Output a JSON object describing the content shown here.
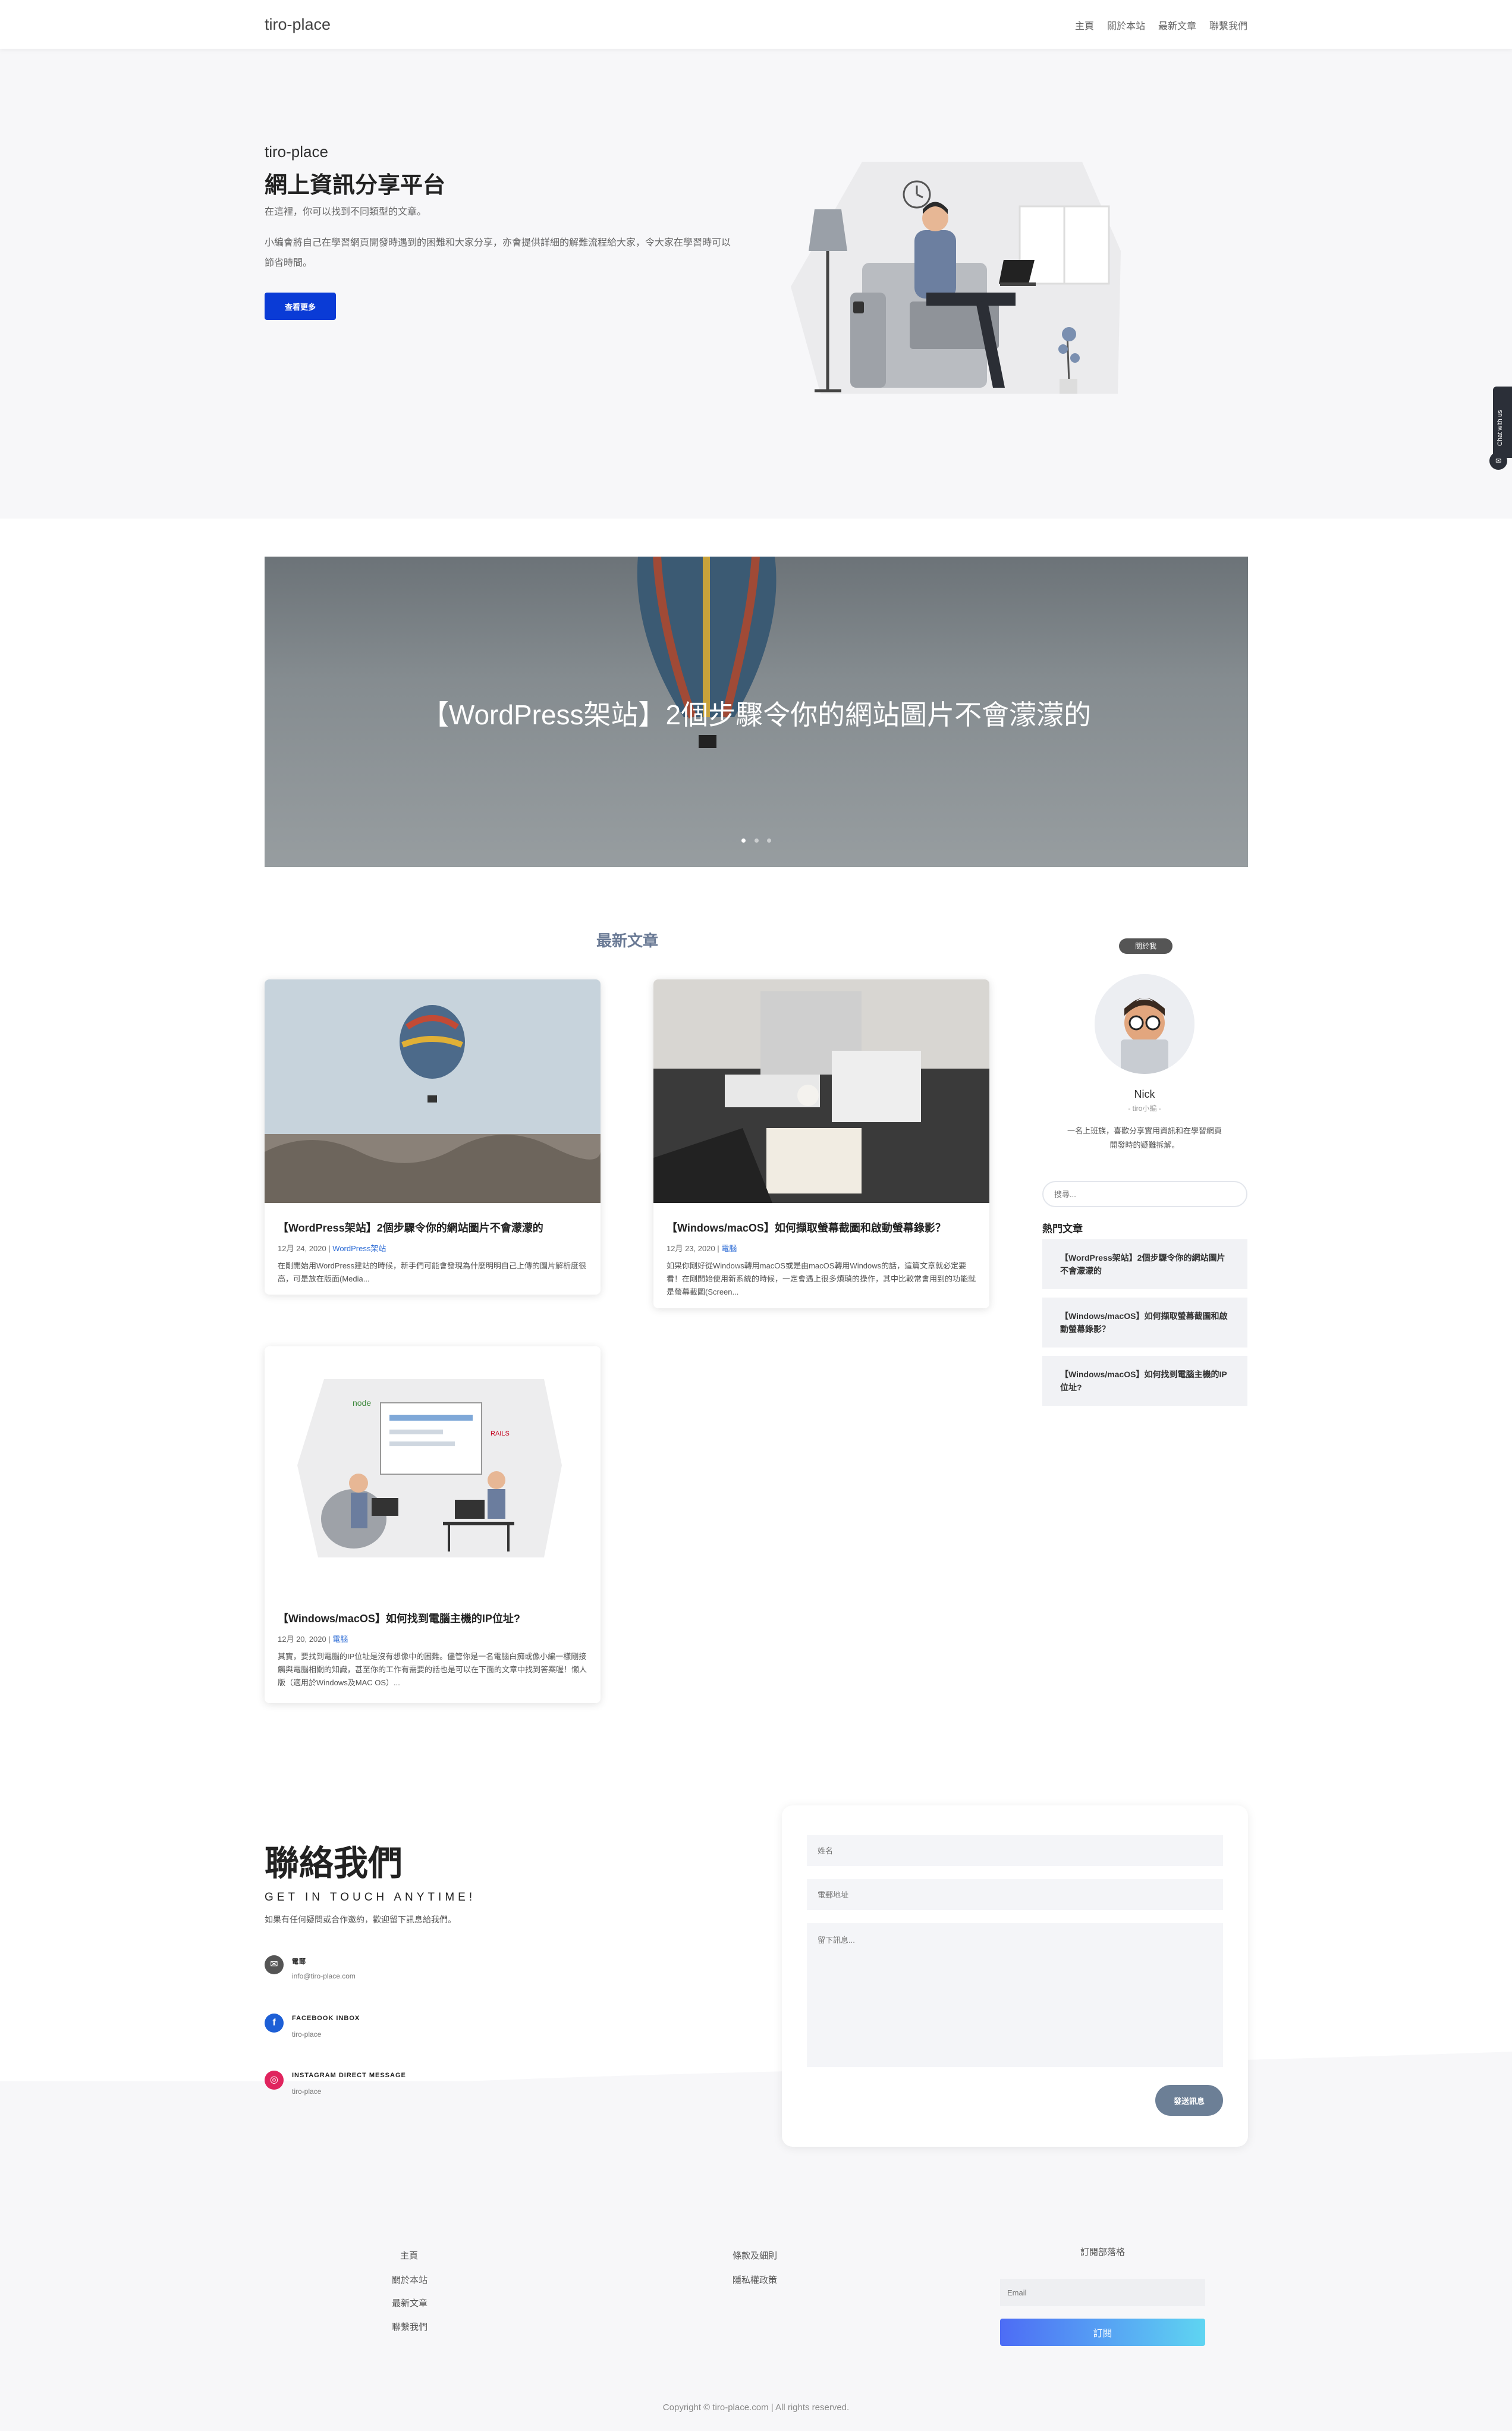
{
  "nav": {
    "brand": "tiro-place",
    "items": [
      "主頁",
      "關於本站",
      "最新文章",
      "聯繫我們"
    ]
  },
  "hero": {
    "sup": "tiro-place",
    "title": "網上資訊分享平台",
    "subtitle": "在這裡，你可以找到不同類型的文章。",
    "desc": "小編會將自己在學習網頁開發時遇到的困難和大家分享，亦會提供詳細的解難流程給大家，令大家在學習時可以節省時間。",
    "button": "查看更多"
  },
  "slider": {
    "caption": "【WordPress架站】2個步驟令你的網站圖片不會濛濛的",
    "dots": 3,
    "active_dot": 0
  },
  "latest": {
    "title": "最新文章",
    "posts": [
      {
        "title": "【WordPress架站】2個步驟令你的網站圖片不會濛濛的",
        "date": "12月 24, 2020 | ",
        "category": "WordPress架站",
        "excerpt": "在剛開始用WordPress建站的時候，新手們可能會發現為什麼明明自己上傳的圖片解析度很高，可是放在版面(Media..."
      },
      {
        "title": "【Windows/macOS】如何擷取螢幕截圖和啟動螢幕錄影？",
        "date": "12月 23, 2020 | ",
        "category": "電腦",
        "excerpt": "如果你剛好從Windows轉用macOS或是由macOS轉用Windows的話，這篇文章就必定要看！在剛開始使用新系統的時候，一定會遇上很多煩瑣的操作，其中比較常會用到的功能就是螢幕截圖(Screen..."
      },
      {
        "title": "【Windows/macOS】如何找到電腦主機的IP位址?",
        "date": "12月 20, 2020 | ",
        "category": "電腦",
        "excerpt": "其實，要找到電腦的IP位址是沒有想像中的困難。儘管你是一名電腦白痴或像小編一樣剛接觸與電腦相關的知識，甚至你的工作有需要的話也是可以在下面的文章中找到答案喔！懶人版（適用於Windows及MAC OS）..."
      }
    ]
  },
  "about": {
    "badge": "關於我",
    "name": "Nick",
    "role": "- tiro小編 -",
    "desc": "一名上班族，喜歡分享實用資訊和在學習網頁開發時的疑難拆解。",
    "search_placeholder": "搜尋...",
    "popular_title": "熱門文章",
    "popular": [
      "【WordPress架站】2個步驟令你的網站圖片不會濛濛的",
      "【Windows/macOS】如何擷取螢幕截圖和啟動螢幕錄影？",
      "【Windows/macOS】如何找到電腦主機的IP位址?"
    ]
  },
  "contact": {
    "title": "聯絡我們",
    "subtitle": "GET IN TOUCH ANYTIME!",
    "desc": "如果有任何疑問或合作邀約，歡迎留下訊息給我們。",
    "items": [
      {
        "label": "電郵",
        "value": "info@tiro-place.com",
        "icon": "mail-icon",
        "color": "#555555"
      },
      {
        "label": "FACEBOOK INBOX",
        "value": "tiro-place",
        "icon": "facebook-icon",
        "color": "#1d5fd6"
      },
      {
        "label": "INSTAGRAM DIRECT MESSAGE",
        "value": "tiro-place",
        "icon": "instagram-icon",
        "color": "#e0245e"
      }
    ],
    "form": {
      "name_placeholder": "姓名",
      "email_placeholder": "電郵地址",
      "message_placeholder": "留下訊息...",
      "send": "發送訊息"
    }
  },
  "footer": {
    "col1": [
      "主頁",
      "關於本站",
      "最新文章",
      "聯繫我們"
    ],
    "col2": [
      "條款及細則",
      "隱私權政策"
    ],
    "subscribe_title": "訂閱部落格",
    "email_placeholder": "Email",
    "subscribe_button": "訂閱",
    "copyright": "Copyright © tiro-place.com | All rights reserved."
  },
  "chat": {
    "tab_label": "Chat with us"
  }
}
